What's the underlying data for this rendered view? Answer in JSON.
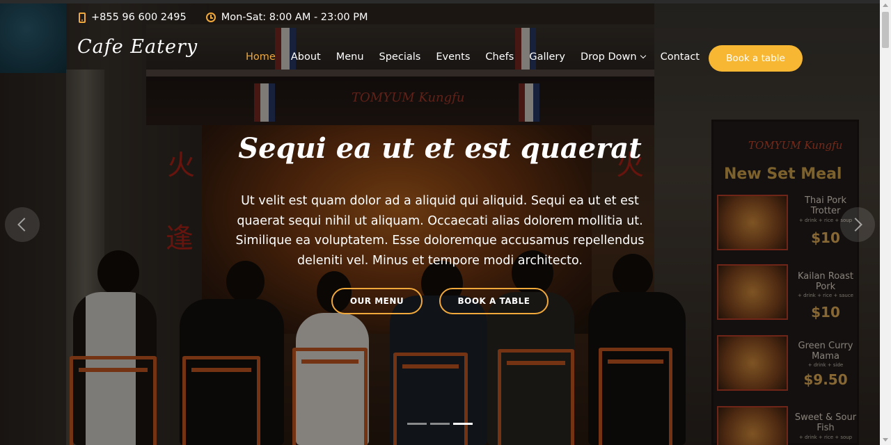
{
  "topbar": {
    "phone": "+855 96 600 2495",
    "hours": "Mon-Sat: 8:00 AM - 23:00 PM",
    "phone_icon": "phone-icon",
    "hours_icon": "clock-icon"
  },
  "header": {
    "logo": "Cafe Eatery",
    "nav": [
      {
        "label": "Home",
        "active": true
      },
      {
        "label": "About"
      },
      {
        "label": "Menu"
      },
      {
        "label": "Specials"
      },
      {
        "label": "Events"
      },
      {
        "label": "Chefs"
      },
      {
        "label": "Gallery"
      },
      {
        "label": "Drop Down"
      },
      {
        "label": "Contact"
      }
    ],
    "book_button": "Book a table"
  },
  "hero": {
    "title": "Sequi ea ut et est quaerat",
    "text": "Ut velit est quam dolor ad a aliquid qui aliquid. Sequi ea ut et est quaerat sequi nihil ut aliquam. Occaecati alias dolorem mollitia ut. Similique ea voluptatem. Esse doloremque accusamus repellendus deleniti vel. Minus et tempore modi architecto.",
    "menu_button": "OUR MENU",
    "table_button": "BOOK A TABLE",
    "slides_total": 3,
    "slide_active": 3
  },
  "background_photo": {
    "shop_sign": "TOMYUM Kungfu",
    "board_brand": "TOMYUM Kungfu",
    "board_title": "New Set Meal",
    "items": [
      {
        "name": "Thai Pork Trotter",
        "sub": "+ drink + rice + soup",
        "price": "$10"
      },
      {
        "name": "Kailan Roast Pork",
        "sub": "+ drink + rice + sauce",
        "price": "$10"
      },
      {
        "name": "Green Curry Mama",
        "sub": "+ drink + side",
        "price": "$9.50"
      },
      {
        "name": "Sweet & Sour Fish",
        "sub": "+ drink + rice + soup",
        "price": ""
      }
    ]
  },
  "colors": {
    "accent": "#f2a93b",
    "book_button_bg": "#f7b733"
  }
}
